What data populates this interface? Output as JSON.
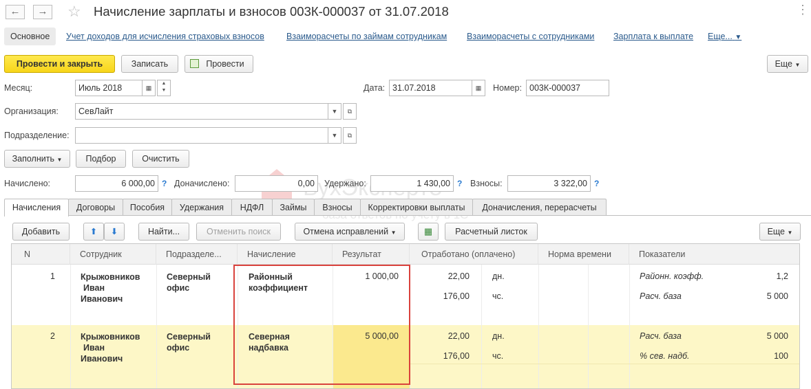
{
  "window": {
    "title": "Начисление зарплаты и взносов 003К-000037 от 31.07.2018",
    "back_glyph": "←",
    "forward_glyph": "→",
    "star_glyph": "☆",
    "close_glyph": "⋮"
  },
  "nav": {
    "main": "Основное",
    "links": [
      "Учет доходов для исчисления страховых взносов",
      "Взаиморасчеты по займам сотрудникам",
      "Взаиморасчеты с сотрудниками",
      "Зарплата к выплате",
      "Еще..."
    ]
  },
  "toolbar": {
    "post_close": "Провести и закрыть",
    "write": "Записать",
    "post": "Провести",
    "more": "Еще"
  },
  "form": {
    "month_label": "Месяц:",
    "month_value": "Июль 2018",
    "date_label": "Дата:",
    "date_value": "31.07.2018",
    "number_label": "Номер:",
    "number_value": "003К-000037",
    "org_label": "Организация:",
    "org_value": "СевЛайт",
    "dept_label": "Подразделение:",
    "dept_value": ""
  },
  "actions": {
    "fill": "Заполнить",
    "select": "Подбор",
    "clear": "Очистить"
  },
  "totals": {
    "accrued_label": "Начислено:",
    "accrued_value": "6 000,00",
    "extra_label": "Доначислено:",
    "extra_value": "0,00",
    "withheld_label": "Удержано:",
    "withheld_value": "1 430,00",
    "contrib_label": "Взносы:",
    "contrib_value": "3 322,00",
    "help": "?"
  },
  "watermark": {
    "brand": "БухЭксперт8",
    "tagline": "база ответов по учету в 1С"
  },
  "tabs": [
    "Начисления",
    "Договоры",
    "Пособия",
    "Удержания",
    "НДФЛ",
    "Займы",
    "Взносы",
    "Корректировки выплаты",
    "Доначисления, перерасчеты"
  ],
  "grid_toolbar": {
    "add": "Добавить",
    "find": "Найти...",
    "cancel_search": "Отменить поиск",
    "cancel_fix": "Отмена исправлений",
    "payslip": "Расчетный листок",
    "more": "Еще"
  },
  "columns": [
    "N",
    "Сотрудник",
    "Подразделе...",
    "Начисление",
    "Результат",
    "Отработано (оплачено)",
    "Норма времени",
    "Показатели"
  ],
  "rows": [
    {
      "n": "1",
      "employee": [
        "Крыжовников",
        "Иван",
        "Иванович"
      ],
      "dept": [
        "Северный",
        "офис"
      ],
      "accrual": [
        "Районный",
        "коэффициент"
      ],
      "result": "1 000,00",
      "worked": [
        "22,00",
        "176,00"
      ],
      "units": [
        "дн.",
        "чс."
      ],
      "indicators": [
        "Районн. коэфф.",
        "Расч. база"
      ],
      "ind_values": [
        "1,2",
        "5 000"
      ]
    },
    {
      "n": "2",
      "employee": [
        "Крыжовников",
        "Иван",
        "Иванович"
      ],
      "dept": [
        "Северный",
        "офис"
      ],
      "accrual": [
        "Северная",
        "надбавка"
      ],
      "result": "5 000,00",
      "worked": [
        "22,00",
        "176,00"
      ],
      "units": [
        "дн.",
        "чс."
      ],
      "indicators": [
        "Расч. база",
        "% сев. надб."
      ],
      "ind_values": [
        "5 000",
        "100"
      ]
    }
  ],
  "colors": {
    "accent_yellow": "#f7d51a",
    "row_highlight": "#fdf7c7",
    "highlight_box": "#d9413c",
    "link": "#2a5a8c"
  }
}
